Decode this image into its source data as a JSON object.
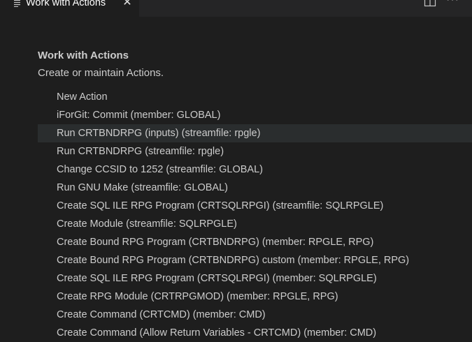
{
  "tab": {
    "title": "Work with Actions",
    "icon": "preview-icon",
    "close_glyph": "✕"
  },
  "toolbar": {
    "split_icon": "split-editor-icon",
    "more_glyph": "···"
  },
  "page": {
    "title": "Work with Actions",
    "subtitle": "Create or maintain Actions."
  },
  "actions": [
    "New Action",
    "iForGit: Commit (member: GLOBAL)",
    "Run CRTBNDRPG (inputs) (streamfile: rpgle)",
    "Run CRTBNDRPG (streamfile: rpgle)",
    "Change CCSID to 1252 (streamfile: GLOBAL)",
    "Run GNU Make (streamfile: GLOBAL)",
    "Create SQL ILE RPG Program (CRTSQLRPGI) (streamfile: SQLRPGLE)",
    "Create Module (streamfile: SQLRPGLE)",
    "Create Bound RPG Program (CRTBNDRPG) (member: RPGLE, RPG)",
    "Create Bound RPG Program (CRTBNDRPG) custom (member: RPGLE, RPG)",
    "Create SQL ILE RPG Program (CRTSQLRPGI) (member: SQLRPGLE)",
    "Create RPG Module (CRTRPGMOD) (member: RPGLE, RPG)",
    "Create Command (CRTCMD) (member: CMD)",
    "Create Command (Allow Return Variables - CRTCMD) (member: CMD)"
  ],
  "selected_index": 2,
  "colors": {
    "background": "#1e1e1e",
    "tabbar": "#252526",
    "text": "#cccccc",
    "hover": "#2a2d2e"
  }
}
